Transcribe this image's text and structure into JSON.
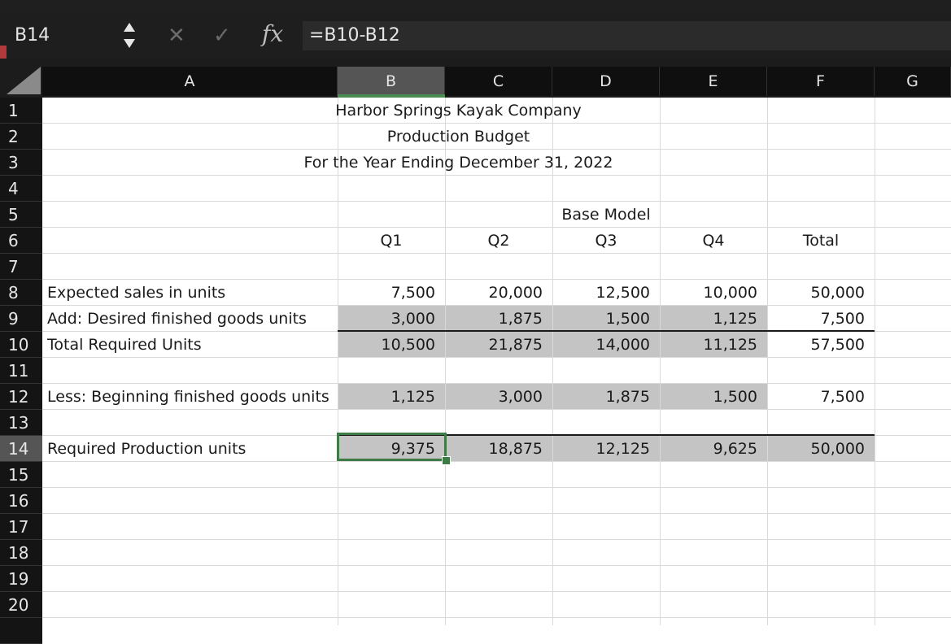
{
  "formula_bar": {
    "name_box": "B14",
    "fx_label": "fx",
    "cancel_glyph": "✕",
    "enter_glyph": "✓",
    "formula": "=B10-B12"
  },
  "columns": [
    "A",
    "B",
    "C",
    "D",
    "E",
    "F",
    "G"
  ],
  "selected_column": "B",
  "rows": [
    "1",
    "2",
    "3",
    "4",
    "5",
    "6",
    "7",
    "8",
    "9",
    "10",
    "11",
    "12",
    "13",
    "14",
    "15",
    "16",
    "17",
    "18",
    "19",
    "20"
  ],
  "selected_row": "14",
  "sheet": {
    "title": "Harbor Springs Kayak Company",
    "subtitle": "Production Budget",
    "period": "For the Year Ending December 31, 2022",
    "model": "Base Model",
    "headers": [
      "Q1",
      "Q2",
      "Q3",
      "Q4",
      "Total"
    ],
    "lines": [
      {
        "label": "Expected sales in units",
        "values": [
          "7,500",
          "20,000",
          "12,500",
          "10,000",
          "50,000"
        ]
      },
      {
        "label": "Add: Desired finished goods units",
        "values": [
          "3,000",
          "1,875",
          "1,500",
          "1,125",
          "7,500"
        ]
      },
      {
        "label": "Total Required Units",
        "values": [
          "10,500",
          "21,875",
          "14,000",
          "11,125",
          "57,500"
        ]
      },
      {
        "label": "Less: Beginning finished goods units",
        "values": [
          "1,125",
          "3,000",
          "1,875",
          "1,500",
          "7,500"
        ]
      },
      {
        "label": "Required Production units",
        "values": [
          "9,375",
          "18,875",
          "12,125",
          "9,625",
          "50,000"
        ]
      }
    ]
  },
  "colors": {
    "selection_green": "#3f7b47",
    "input_fill": "#c4c4c4",
    "header_dark": "#141414"
  }
}
